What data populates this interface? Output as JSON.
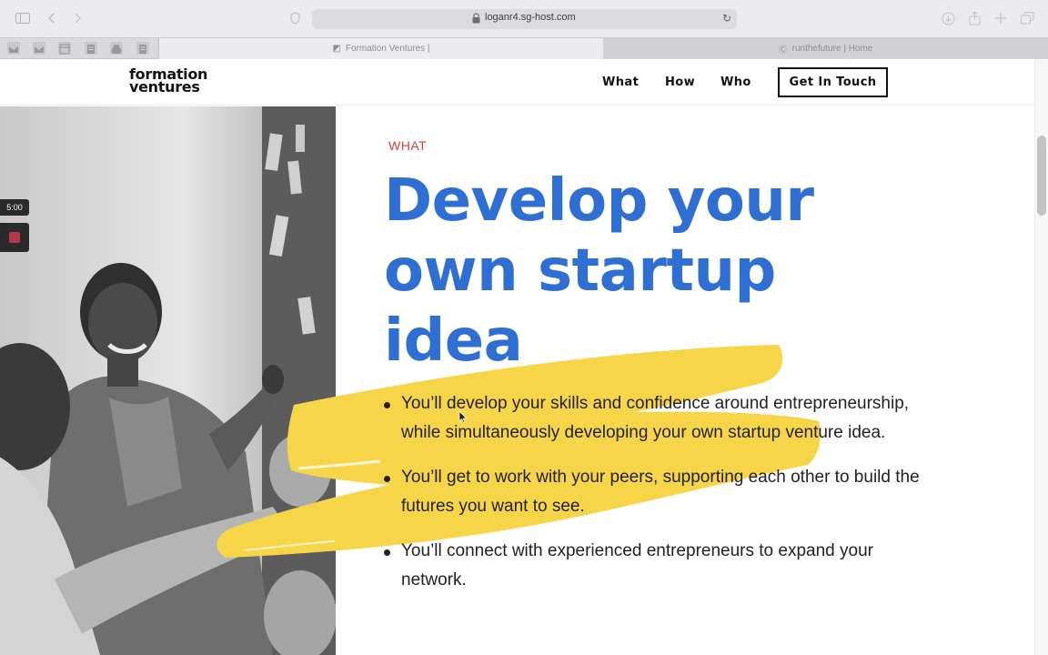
{
  "browser": {
    "url": "loganr4.sg-host.com",
    "tabs": [
      {
        "label": "Formation Ventures |",
        "active": true
      },
      {
        "label": "runthefuture | Home",
        "active": false
      }
    ]
  },
  "site": {
    "logo_line1": "formation",
    "logo_line2": "ventures",
    "nav": [
      {
        "label": "What"
      },
      {
        "label": "How"
      },
      {
        "label": "Who"
      }
    ],
    "cta_label": "Get In Touch"
  },
  "section": {
    "eyebrow": "WHAT",
    "headline_line1": "Develop your",
    "headline_line2": "own startup",
    "headline_line3": "idea",
    "bullets": [
      "You’ll develop your skills and confidence around entrepreneurship, while simultaneously developing your own startup venture idea.",
      "You’ll get to work with your peers, supporting each other to build the futures you want to see.",
      "You’ll connect with experienced entrepreneurs to expand your network."
    ]
  },
  "recorder": {
    "timer": "5:00"
  },
  "colors": {
    "accent_blue": "#2f6fd3",
    "eyebrow_red": "#d6423f",
    "brush_yellow": "#f7d548"
  }
}
